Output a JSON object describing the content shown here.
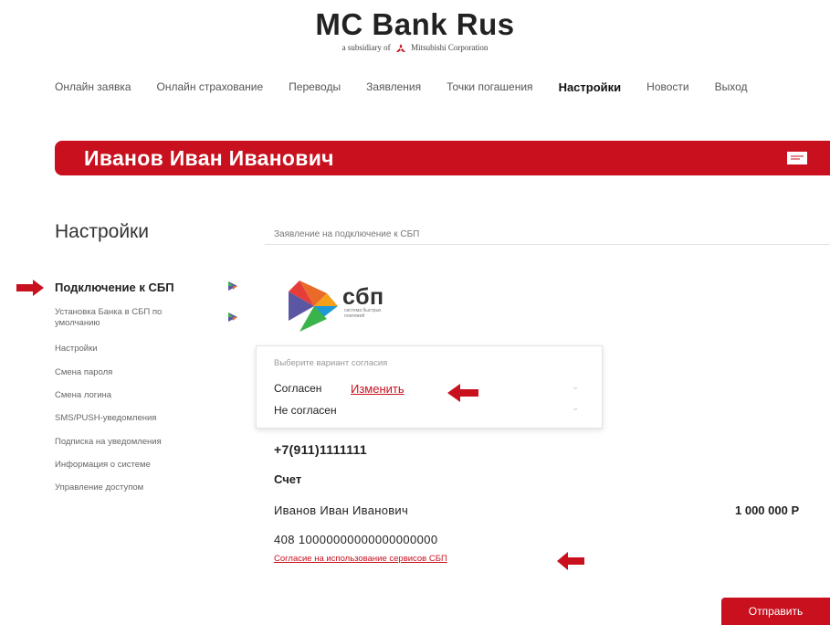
{
  "brand": {
    "title": "MC Bank Rus",
    "subtitle_prefix": "a subsidiary of",
    "subtitle_company": "Mitsubishi Corporation"
  },
  "nav": {
    "items": [
      {
        "label": "Онлайн заявка"
      },
      {
        "label": "Онлайн страхование"
      },
      {
        "label": "Переводы"
      },
      {
        "label": "Заявления"
      },
      {
        "label": "Точки погашения"
      },
      {
        "label": "Настройки",
        "active": true
      },
      {
        "label": "Новости"
      },
      {
        "label": "Выход"
      }
    ]
  },
  "banner": {
    "user_name": "Иванов Иван Иванович",
    "icon": "message-icon"
  },
  "sidebar": {
    "title": "Настройки",
    "items": [
      {
        "label": "Подключение к СБП",
        "active": true
      },
      {
        "label": "Установка Банка в СБП по умолчанию"
      },
      {
        "label": "Настройки"
      },
      {
        "label": "Смена пароля"
      },
      {
        "label": "Смена логина"
      },
      {
        "label": "SMS/PUSH-уведомления"
      },
      {
        "label": "Подписка на уведомления"
      },
      {
        "label": "Информация о системе"
      },
      {
        "label": "Управление доступом"
      }
    ]
  },
  "main": {
    "heading": "Заявление на подключение к СБП",
    "sbp_logo_text": "сбп",
    "sbp_tagline": "система быстрых платежей",
    "consent": {
      "label": "Выберите вариант согласия",
      "options": [
        "Согласен",
        "Не согласен"
      ],
      "change_link": "Изменить"
    },
    "phone": "+7(911)1111111",
    "account_label": "Счет",
    "account_holder": "Иванов Иван Иванович",
    "account_balance": "1 000 000 Р",
    "account_number": "408 10000000000000000000",
    "agreement_link": "Согласие на использование сервисов СБП",
    "submit_label": "Отправить"
  },
  "colors": {
    "accent": "#c8101e",
    "text": "#222222",
    "muted": "#777777"
  }
}
